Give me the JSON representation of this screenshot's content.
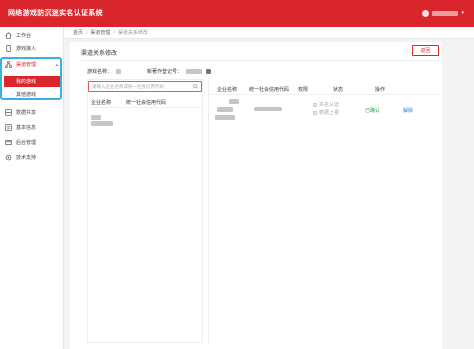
{
  "app": {
    "title": "网络游戏防沉迷实名认证系统"
  },
  "sidebar": {
    "items": [
      {
        "label": "工作台",
        "icon": "home-icon"
      },
      {
        "label": "游戏接入",
        "icon": "phone-icon"
      },
      {
        "label": "渠道管理",
        "icon": "channel-icon"
      },
      {
        "label": "数据共享",
        "icon": "share-icon"
      },
      {
        "label": "基本信息",
        "icon": "info-icon"
      },
      {
        "label": "后台管理",
        "icon": "admin-icon"
      },
      {
        "label": "技术支持",
        "icon": "support-icon"
      }
    ],
    "sub_items": [
      {
        "label": "我的游戏"
      },
      {
        "label": "其他游戏"
      }
    ]
  },
  "breadcrumb": {
    "home": "首页",
    "level1": "渠道管理",
    "current": "渠道关系修改"
  },
  "page": {
    "title": "渠道关系修改",
    "back_label": "返回",
    "game_name_label": "游戏名称：",
    "reg_no_label": "新著作登记号：",
    "search_placeholder": "请输入企业名称或统一社会信用代码"
  },
  "left_table": {
    "columns": [
      "企业名称",
      "统一社会信用代码"
    ]
  },
  "right_table": {
    "columns": [
      "企业名称",
      "统一社会信用代码",
      "权限",
      "状态",
      "操作"
    ],
    "rows": [
      {
        "perm1": "实名认证",
        "perm2": "数据上报",
        "status": "已确认",
        "action": "解除"
      }
    ]
  },
  "colors": {
    "brand": "#d9262c",
    "highlight": "#3cb0e2",
    "ok": "#2aa35a",
    "link": "#2d7be0"
  }
}
